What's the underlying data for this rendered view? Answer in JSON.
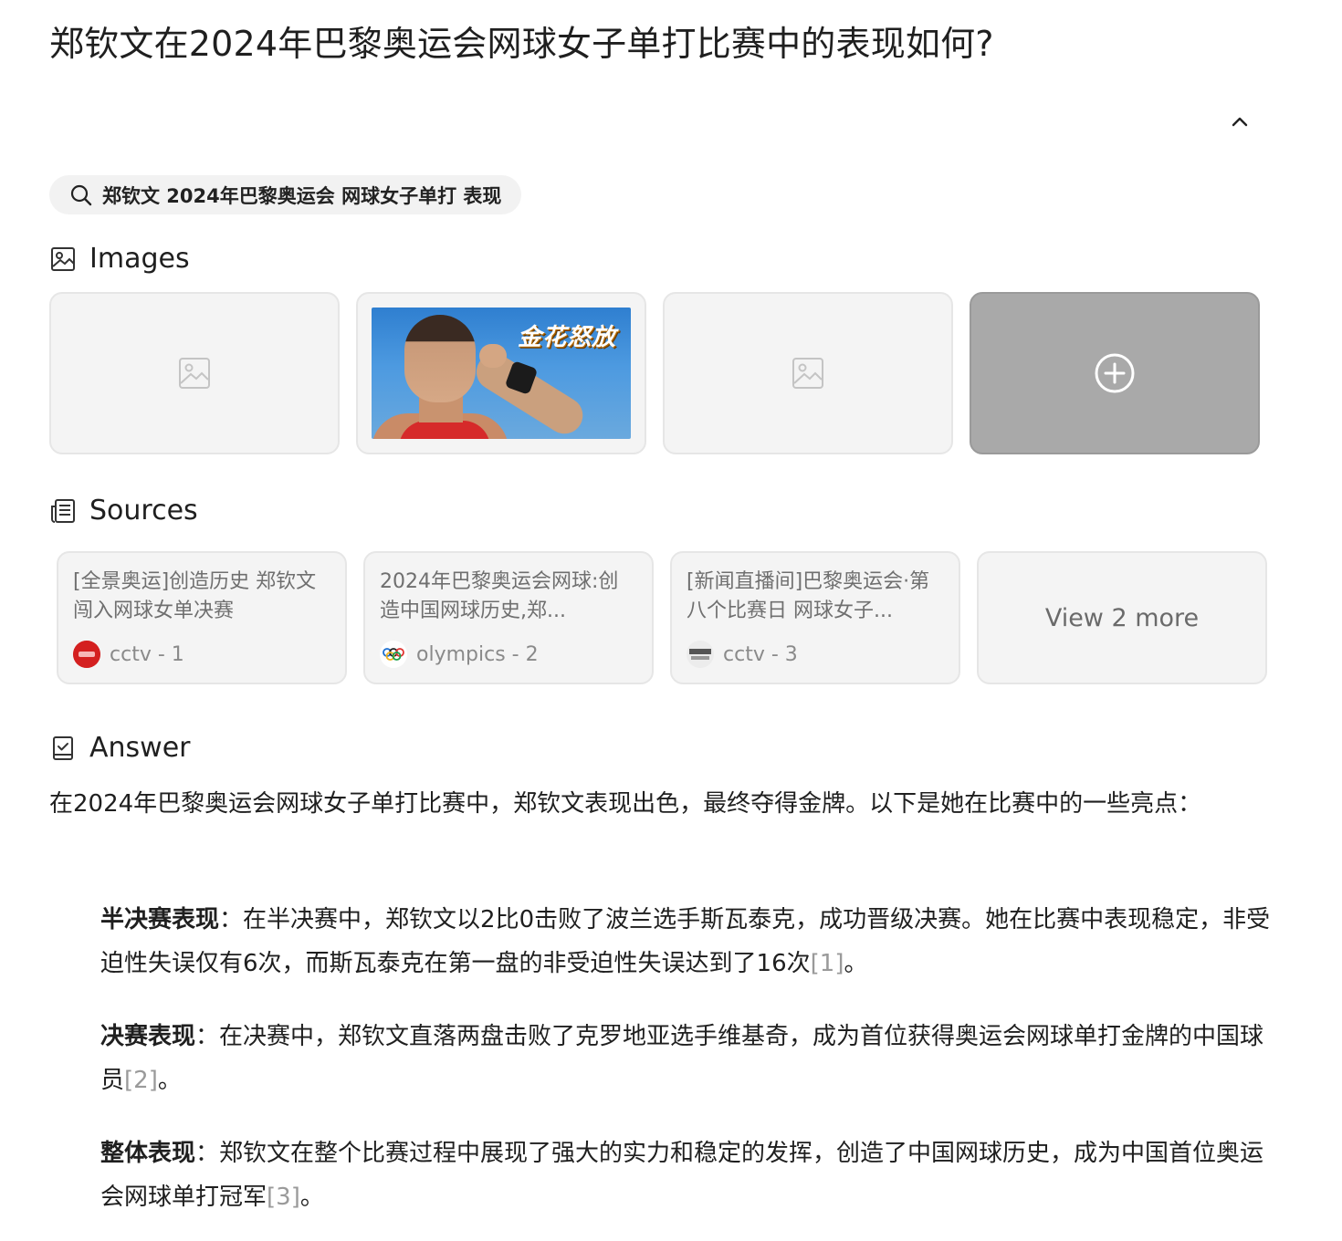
{
  "question": "郑钦文在2024年巴黎奥运会网球女子单打比赛中的表现如何?",
  "search_query": "郑钦文 2024年巴黎奥运会 网球女子单打 表现",
  "images_section": {
    "heading": "Images",
    "photo_overlay_text": "金花怒放"
  },
  "sources_section": {
    "heading": "Sources",
    "items": [
      {
        "title": "[全景奥运]创造历史 郑钦文闯入网球女单决赛",
        "source": "cctv - 1"
      },
      {
        "title": "2024年巴黎奥运会网球:创造中国网球历史,郑...",
        "source": "olympics - 2"
      },
      {
        "title": "[新闻直播间]巴黎奥运会·第八个比赛日 网球女子...",
        "source": "cctv - 3"
      }
    ],
    "view_more_label": "View 2 more"
  },
  "answer_section": {
    "heading": "Answer",
    "intro": "在2024年巴黎奥运会网球女子单打比赛中，郑钦文表现出色，最终夺得金牌。以下是她在比赛中的一些亮点：",
    "points": [
      {
        "title": "半决赛表现",
        "sep": "：",
        "text": "在半决赛中，郑钦文以2比0击败了波兰选手斯瓦泰克，成功晋级决赛。她在比赛中表现稳定，非受迫性失误仅有6次，而斯瓦泰克在第一盘的非受迫性失误达到了16次",
        "cite": "[1]",
        "end": "。"
      },
      {
        "title": "决赛表现",
        "sep": "：",
        "text": "在决赛中，郑钦文直落两盘击败了克罗地亚选手维基奇，成为首位获得奥运会网球单打金牌的中国球员",
        "cite": "[2]",
        "end": "。"
      },
      {
        "title": "整体表现",
        "sep": "：",
        "text": "郑钦文在整个比赛过程中展现了强大的实力和稳定的发挥，创造了中国网球历史，成为中国首位奥运会网球单打冠军",
        "cite": "[3]",
        "end": "。"
      }
    ]
  },
  "colors": {
    "chip_bg": "#f2f2f2",
    "card_bg": "#f4f4f4",
    "more_card_bg": "#a9a9a9",
    "cite_gray": "#9a9a9a",
    "cctv_red": "#d42020"
  },
  "icons": {
    "collapse": "chevron-up-icon",
    "search": "search-icon",
    "images": "image-icon",
    "sources": "newspaper-icon",
    "answer": "answer-book-icon",
    "placeholder": "image-placeholder-icon",
    "more": "plus-circle-icon"
  }
}
